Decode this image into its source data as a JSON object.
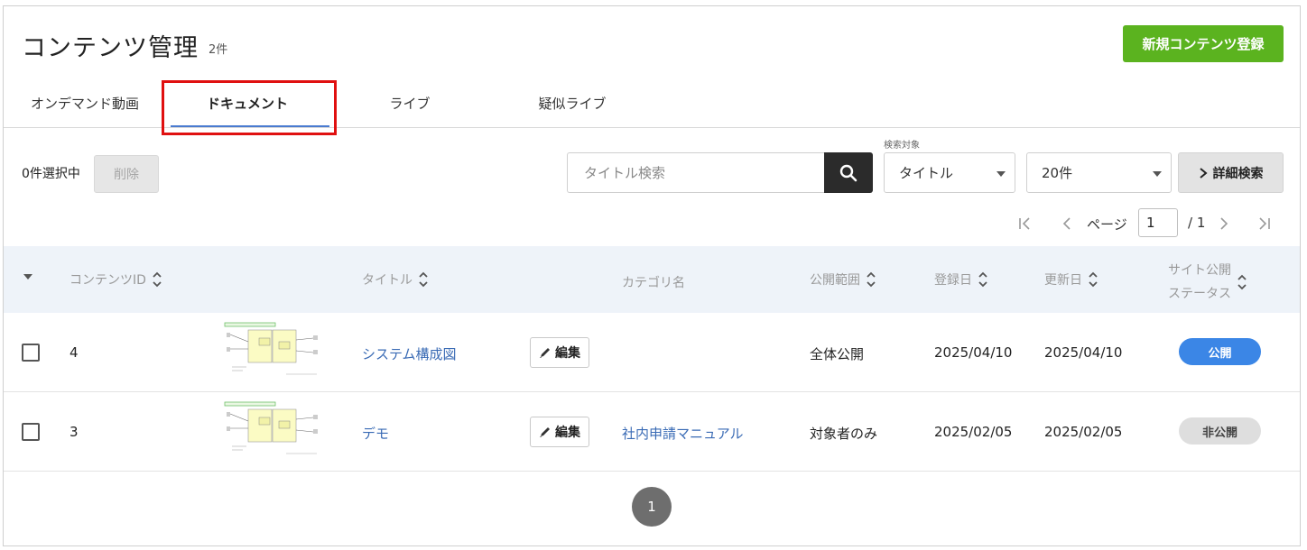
{
  "page": {
    "title": "コンテンツ管理",
    "count": "2件",
    "new_button": "新規コンテンツ登録"
  },
  "tabs": [
    {
      "label": "オンデマンド動画"
    },
    {
      "label": "ドキュメント",
      "active": true
    },
    {
      "label": "ライブ"
    },
    {
      "label": "疑似ライブ"
    }
  ],
  "toolbar": {
    "selected_count": "0件選択中",
    "delete_label": "削除",
    "search_placeholder": "タイトル検索",
    "search_target_label": "検索対象",
    "search_target_value": "タイトル",
    "per_page_value": "20件",
    "advanced_search": "詳細検索"
  },
  "pagination": {
    "page_label": "ページ",
    "current_page": "1",
    "total": "/ 1",
    "bottom_page": "1"
  },
  "table": {
    "headers": {
      "content_id": "コンテンツID",
      "title": "タイトル",
      "category": "カテゴリ名",
      "scope": "公開範囲",
      "registered": "登録日",
      "updated": "更新日",
      "status_line1": "サイト公開",
      "status_line2": "ステータス"
    },
    "rows": [
      {
        "id": "4",
        "title": "システム構成図",
        "edit": "編集",
        "category": "",
        "scope": "全体公開",
        "registered": "2025/04/10",
        "updated": "2025/04/10",
        "status": "公開"
      },
      {
        "id": "3",
        "title": "デモ",
        "edit": "編集",
        "category": "社内申請マニュアル",
        "scope": "対象者のみ",
        "registered": "2025/02/05",
        "updated": "2025/02/05",
        "status": "非公開"
      }
    ]
  },
  "colors": {
    "accent_green": "#5bb31f",
    "link_blue": "#3a6bb5",
    "badge_public": "#3b86e6",
    "highlight_red": "#e01010"
  }
}
